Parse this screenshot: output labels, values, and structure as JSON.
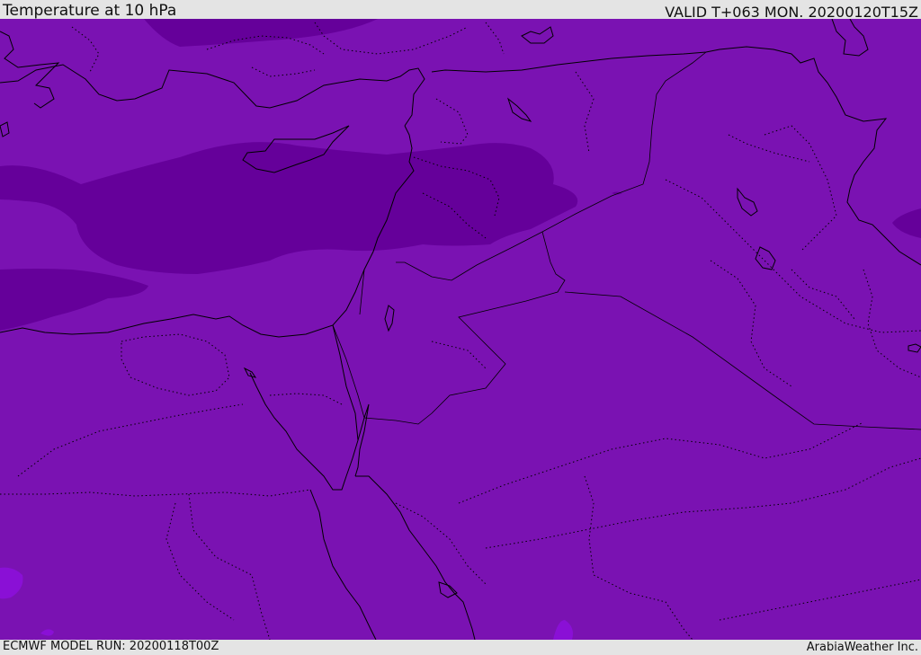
{
  "header": {
    "title": "Temperature at 10 hPa",
    "valid": "VALID T+063 MON. 20200120T15Z"
  },
  "footer": {
    "model_run": "ECMWF MODEL RUN: 20200118T00Z",
    "credit": "ArabiaWeather Inc."
  },
  "map": {
    "colors": {
      "base_field": "#7a12b2",
      "cold_field": "#65009a",
      "warm_spot": "#8a10d6",
      "coastline": "#000000"
    }
  }
}
